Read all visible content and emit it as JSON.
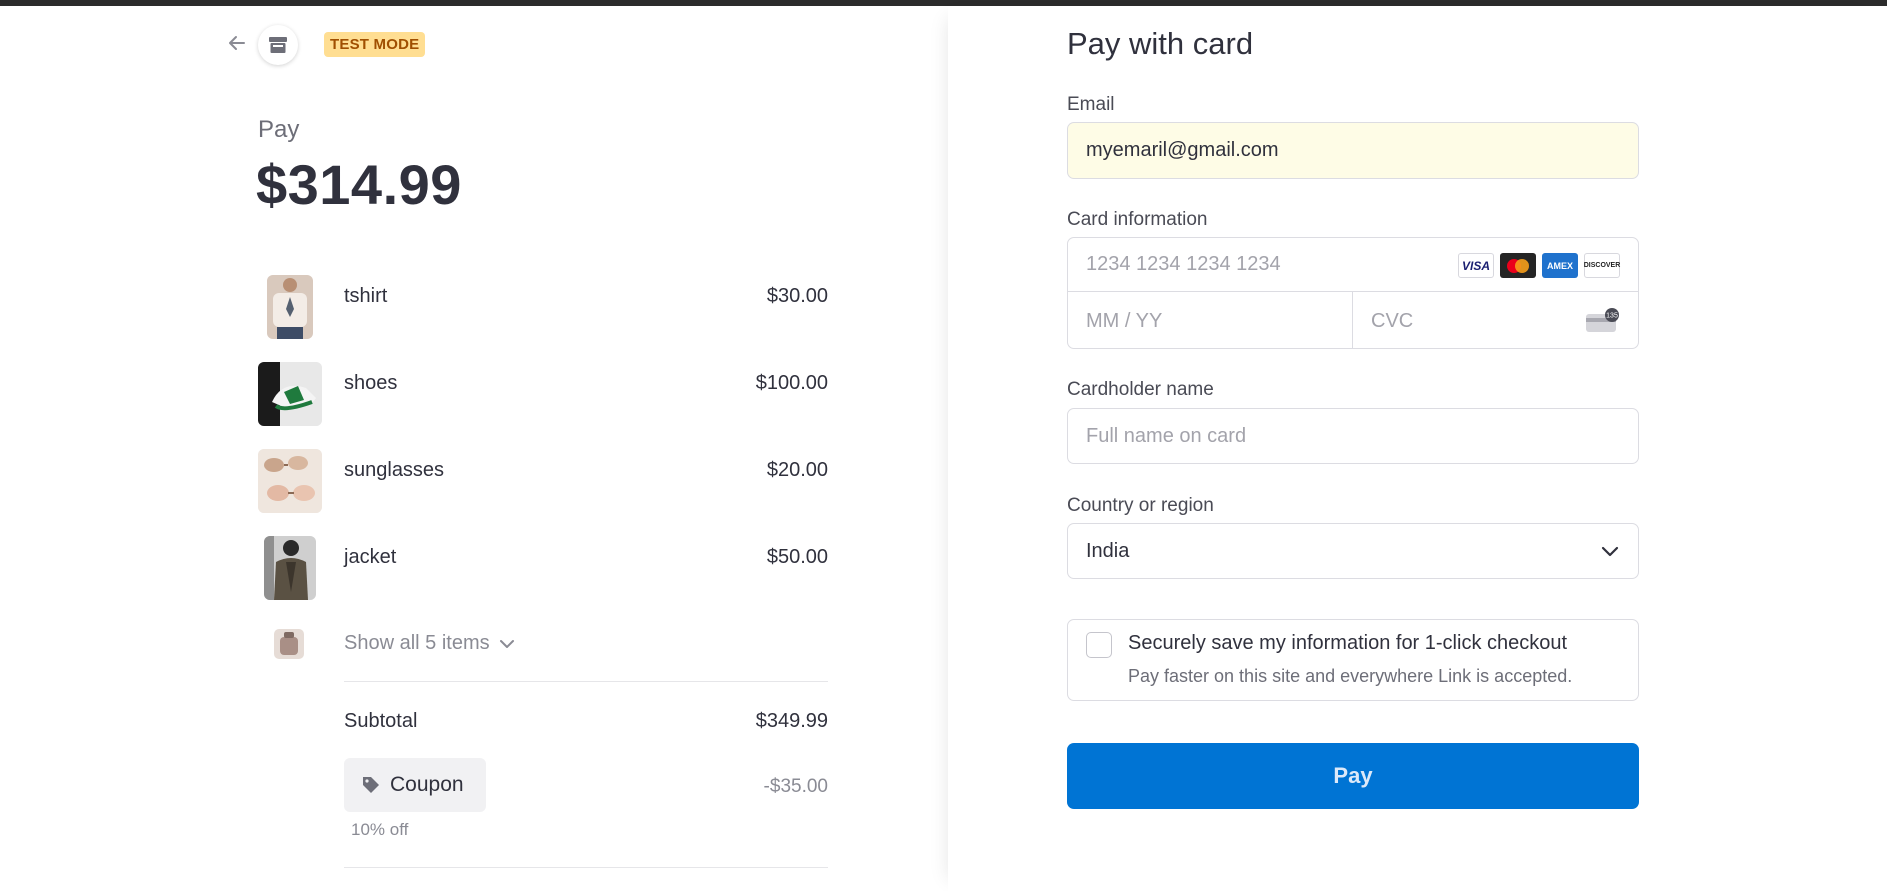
{
  "header": {
    "test_mode": "TEST MODE"
  },
  "summary": {
    "pay_label": "Pay",
    "amount": "$314.99",
    "items": [
      {
        "name": "tshirt",
        "price": "$30.00"
      },
      {
        "name": "shoes",
        "price": "$100.00"
      },
      {
        "name": "sunglasses",
        "price": "$20.00"
      },
      {
        "name": "jacket",
        "price": "$50.00"
      }
    ],
    "show_all": "Show all 5 items",
    "subtotal_label": "Subtotal",
    "subtotal_value": "$349.99",
    "coupon_label": "Coupon",
    "coupon_discount": "-$35.00",
    "coupon_note": "10% off"
  },
  "form": {
    "title": "Pay with card",
    "email_label": "Email",
    "email_value": "myemaril@gmail.com",
    "card_label": "Card information",
    "card_number_placeholder": "1234 1234 1234 1234",
    "expiry_placeholder": "MM / YY",
    "cvc_placeholder": "CVC",
    "card_brands": [
      "VISA",
      "Mastercard",
      "AMEX",
      "DISCOVER"
    ],
    "cvc_icon_text": "135",
    "cardholder_label": "Cardholder name",
    "cardholder_placeholder": "Full name on card",
    "country_label": "Country or region",
    "country_value": "India",
    "save_title": "Securely save my information for 1-click checkout",
    "save_subtitle": "Pay faster on this site and everywhere Link is accepted.",
    "pay_button": "Pay"
  },
  "colors": {
    "accent": "#0074d4",
    "test_mode_bg": "#ffde92",
    "autofill_bg": "#fefce6"
  }
}
